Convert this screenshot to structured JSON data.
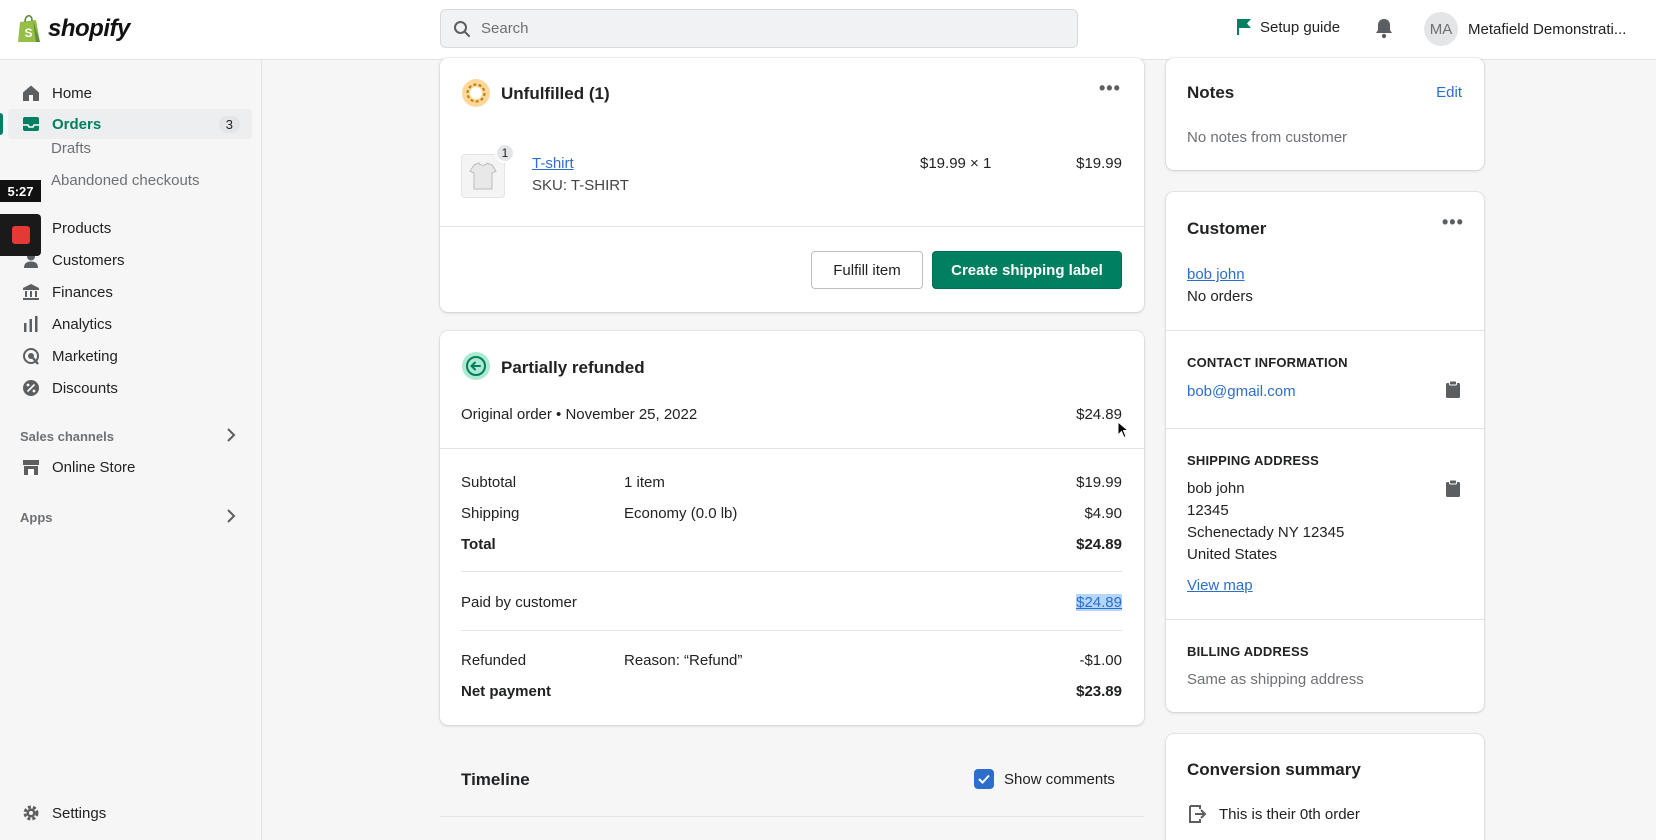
{
  "topbar": {
    "logo_text": "shopify",
    "search_placeholder": "Search",
    "setup_guide": "Setup guide",
    "avatar_initials": "MA",
    "account_name": "Metafield Demonstrati..."
  },
  "sidebar": {
    "items": [
      {
        "label": "Home",
        "icon": "home-icon"
      },
      {
        "label": "Orders",
        "icon": "orders-icon",
        "badge": "3"
      },
      {
        "label": "Products",
        "icon": "products-icon"
      },
      {
        "label": "Customers",
        "icon": "customers-icon"
      },
      {
        "label": "Finances",
        "icon": "finances-icon"
      },
      {
        "label": "Analytics",
        "icon": "analytics-icon"
      },
      {
        "label": "Marketing",
        "icon": "marketing-icon"
      },
      {
        "label": "Discounts",
        "icon": "discounts-icon"
      }
    ],
    "sub_items": [
      "Drafts",
      "Abandoned checkouts"
    ],
    "sales_channels_label": "Sales channels",
    "online_store": "Online Store",
    "apps_label": "Apps",
    "settings": "Settings"
  },
  "overlay": {
    "timer": "5:27"
  },
  "unfulfilled": {
    "title": "Unfulfilled (1)",
    "item_name": "T-shirt",
    "item_sku": "SKU: T-SHIRT",
    "item_qty_badge": "1",
    "item_price_qty": "$19.99 × 1",
    "item_total": "$19.99",
    "fulfill_button": "Fulfill item",
    "shipping_label_button": "Create shipping label"
  },
  "payment": {
    "title": "Partially refunded",
    "original_order": "Original order • November 25, 2022",
    "original_total": "$24.89",
    "rows": [
      {
        "label": "Subtotal",
        "detail": "1 item",
        "amount": "$19.99"
      },
      {
        "label": "Shipping",
        "detail": "Economy (0.0 lb)",
        "amount": "$4.90"
      },
      {
        "label": "Total",
        "detail": "",
        "amount": "$24.89"
      }
    ],
    "paid_label": "Paid by customer",
    "paid_amount": "$24.89",
    "refunded_label": "Refunded",
    "refunded_reason": "Reason: “Refund”",
    "refunded_amount": "-$1.00",
    "net_label": "Net payment",
    "net_amount": "$23.89"
  },
  "timeline": {
    "title": "Timeline",
    "show_comments": "Show comments",
    "show_comments_checked": true
  },
  "notes": {
    "title": "Notes",
    "edit": "Edit",
    "empty": "No notes from customer"
  },
  "customer": {
    "title": "Customer",
    "name": "bob john",
    "orders": "No orders",
    "contact_heading": "CONTACT INFORMATION",
    "email": "bob@gmail.com",
    "shipping_heading": "SHIPPING ADDRESS",
    "address_lines": [
      "bob john",
      "12345",
      "Schenectady NY 12345",
      "United States"
    ],
    "view_map": "View map",
    "billing_heading": "BILLING ADDRESS",
    "billing_value": "Same as shipping address"
  },
  "conversion": {
    "title": "Conversion summary",
    "line1": "This is their 0th order"
  },
  "colors": {
    "primary_green": "#008060",
    "link_blue": "#2c6ecb",
    "checkbox_blue": "#2c6ecb"
  }
}
